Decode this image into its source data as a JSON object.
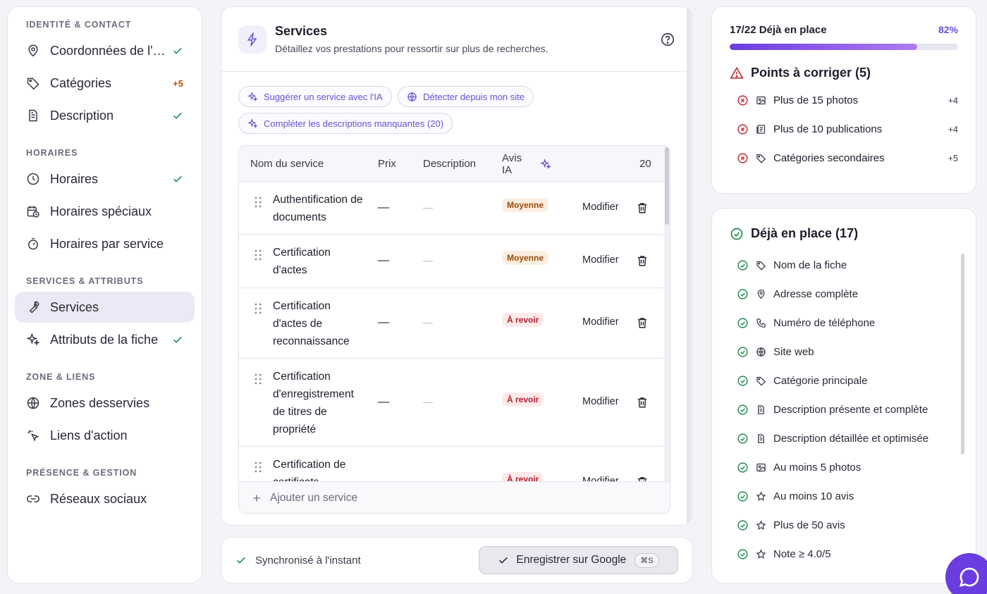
{
  "sidebar": {
    "sections": [
      {
        "title": "IDENTITÉ & CONTACT",
        "items": [
          {
            "label": "Coordonnées de l'établissement",
            "icon": "map-pin-icon",
            "status": "check"
          },
          {
            "label": "Catégories",
            "icon": "tag-icon",
            "badge": "+5"
          },
          {
            "label": "Description",
            "icon": "document-icon",
            "status": "check"
          }
        ]
      },
      {
        "title": "HORAIRES",
        "items": [
          {
            "label": "Horaires",
            "icon": "clock-icon",
            "status": "check"
          },
          {
            "label": "Horaires spéciaux",
            "icon": "calendar-clock-icon"
          },
          {
            "label": "Horaires par service",
            "icon": "timer-icon"
          }
        ]
      },
      {
        "title": "SERVICES & ATTRIBUTS",
        "items": [
          {
            "label": "Services",
            "icon": "wrench-icon",
            "active": true
          },
          {
            "label": "Attributs de la fiche",
            "icon": "sparkles-icon",
            "status": "check"
          }
        ]
      },
      {
        "title": "ZONE & LIENS",
        "items": [
          {
            "label": "Zones desservies",
            "icon": "globe-icon"
          },
          {
            "label": "Liens d'action",
            "icon": "pointer-click-icon"
          }
        ]
      },
      {
        "title": "PRÉSENCE & GESTION",
        "items": [
          {
            "label": "Réseaux sociaux",
            "icon": "link-icon"
          }
        ]
      }
    ]
  },
  "main": {
    "title": "Services",
    "subtitle": "Détaillez vos prestations pour ressortir sur plus de recherches.",
    "actions": [
      {
        "label": "Suggérer un service avec l'IA",
        "icon": "sparkles-icon"
      },
      {
        "label": "Détecter depuis mon site",
        "icon": "globe-icon"
      },
      {
        "label": "Compléter les descriptions manquantes (20)",
        "icon": "sparkles-icon"
      }
    ],
    "table": {
      "headers": {
        "name": "Nom du service",
        "price": "Prix",
        "description": "Description",
        "ai": "Avis IA",
        "count": "20"
      },
      "rows": [
        {
          "name": "Authentification de documents",
          "price": "—",
          "description": "—",
          "ai": "Moyenne",
          "ai_level": "mid",
          "edit": "Modifier"
        },
        {
          "name": "Certification d'actes",
          "price": "—",
          "description": "—",
          "ai": "Moyenne",
          "ai_level": "mid",
          "edit": "Modifier"
        },
        {
          "name": "Certification d'actes de reconnaissance",
          "price": "—",
          "description": "—",
          "ai": "À revoir",
          "ai_level": "bad",
          "edit": "Modifier"
        },
        {
          "name": "Certification d'enregistrement de titres de propriété",
          "price": "—",
          "description": "—",
          "ai": "À revoir",
          "ai_level": "bad",
          "edit": "Modifier"
        },
        {
          "name": "Certification de certificats",
          "price": "—",
          "description": "—",
          "ai": "À revoir",
          "ai_level": "bad",
          "edit": "Modifier"
        }
      ],
      "add_label": "Ajouter un service"
    }
  },
  "footer": {
    "sync": "Synchronisé à l'instant",
    "save": "Enregistrer sur Google",
    "shortcut": "⌘S"
  },
  "score": {
    "label": "17/22 Déjà en place",
    "percent_text": "82%",
    "progress": 0.82,
    "fix_title": "Points à corriger (5)",
    "fix_items": [
      {
        "label": "Plus de 15 photos",
        "icon": "image-icon",
        "count": "+4"
      },
      {
        "label": "Plus de 10 publications",
        "icon": "newspaper-icon",
        "count": "+4"
      },
      {
        "label": "Catégories secondaires",
        "icon": "tag-icon",
        "count": "+5"
      }
    ]
  },
  "done": {
    "title": "Déjà en place (17)",
    "items": [
      {
        "label": "Nom de la fiche",
        "icon": "tag-icon"
      },
      {
        "label": "Adresse complète",
        "icon": "map-pin-icon"
      },
      {
        "label": "Numéro de téléphone",
        "icon": "phone-icon"
      },
      {
        "label": "Site web",
        "icon": "globe-icon"
      },
      {
        "label": "Catégorie principale",
        "icon": "tag-icon"
      },
      {
        "label": "Description présente et complète",
        "icon": "document-icon"
      },
      {
        "label": "Description détaillée et optimisée",
        "icon": "document-icon"
      },
      {
        "label": "Au moins 5 photos",
        "icon": "image-icon"
      },
      {
        "label": "Au moins 10 avis",
        "icon": "star-icon"
      },
      {
        "label": "Plus de 50 avis",
        "icon": "star-icon"
      },
      {
        "label": "Note ≥ 4.0/5",
        "icon": "star-icon"
      }
    ]
  },
  "colors": {
    "accent": "#6a3de0",
    "success": "#1f8a4c",
    "danger": "#c1272d",
    "warning": "#b4540f"
  }
}
